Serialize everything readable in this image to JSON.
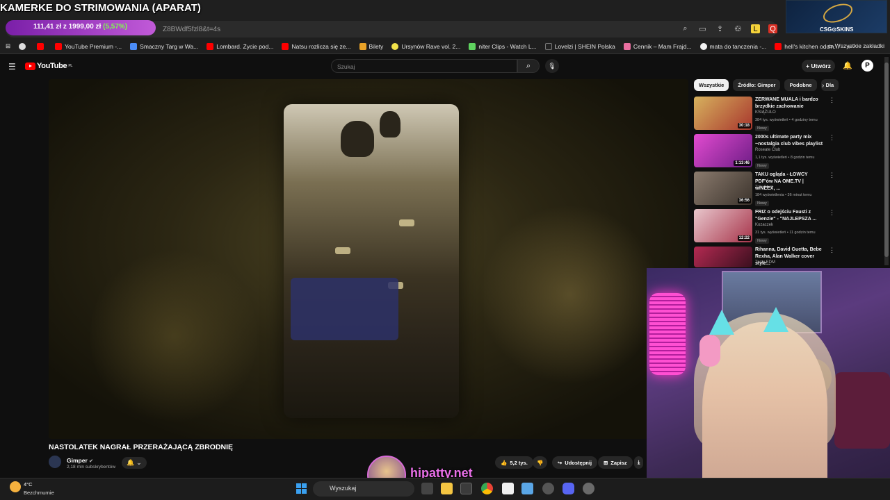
{
  "stream": {
    "title": "KAMERKE DO STRIMOWANIA (APARAT)",
    "goal": {
      "current": "111,41 zł",
      "sep": "z",
      "target": "1999,00 zł",
      "percent": "(5,57%)"
    }
  },
  "browser": {
    "url_fragment": "Z8BWdf5fzl8&t=4s",
    "bookmarks": [
      {
        "label": "YouTube Premium -...",
        "color": "#ff0000"
      },
      {
        "label": "Smaczny Targ w Wa...",
        "color": "#4b8df8"
      },
      {
        "label": "Lombard. Życie pod...",
        "color": "#ff0000"
      },
      {
        "label": "Natsu rozlicza się ze...",
        "color": "#ff0000"
      },
      {
        "label": "Bilety",
        "color": "#e9a227"
      },
      {
        "label": "Ursynów Rave vol. 2...",
        "color": "#f1e24a"
      },
      {
        "label": "niter Clips - Watch L...",
        "color": "#5fd35f"
      },
      {
        "label": "Lovelzi | SHEIN Polska",
        "color": "#222222"
      },
      {
        "label": "Cennik – Mam Frajd...",
        "color": "#e96fa0"
      },
      {
        "label": "mata do tanczenia -...",
        "color": "#f2f2f2"
      },
      {
        "label": "hell's kitchen odcin...",
        "color": "#ff0000"
      }
    ],
    "all_bookmarks": "Wszystkie zakładki",
    "csgo_label": "CSG⊙SKINS"
  },
  "youtube": {
    "logo": "YouTube",
    "region": "PL",
    "search_placeholder": "Szukaj",
    "create_label": "Utwórz",
    "avatar_letter": "P"
  },
  "video": {
    "title": "NASTOLATEK NAGRAŁ PRZERAŻAJĄCĄ ZBRODNIĘ",
    "channel": "Gimper",
    "subscribers": "2,18 mln subskrybentów",
    "likes": "5,2 tys.",
    "share": "Udostępnij",
    "save": "Zapisz"
  },
  "chips": [
    "Wszystkie",
    "Źródło: Gimper",
    "Podobne",
    "Dla"
  ],
  "recommendations": [
    {
      "title": "ZERWANE MUALA i bardzo brzydkie zachowanie",
      "channel": "KSIĄŻULO",
      "meta": "384 tys. wyświetleń • 4 godziny temu",
      "badge": "Nowy",
      "duration": "30:18",
      "thumb": "#c8a24f"
    },
    {
      "title": "2000s ultimate party mix ~nostalgia club vibes playlist",
      "channel": "Roseate Club",
      "meta": "1,1 tys. wyświetleń • 8 godzin temu",
      "badge": "Nowy",
      "duration": "1:13:46",
      "thumb": "#c03ab0"
    },
    {
      "title": "TAKU ogląda - ŁOWCY PDF'ów NA OME.TV | w/NEEX, ...",
      "channel": "TakuShot",
      "meta": "184 wyświetlenia • 36 minut temu",
      "badge": "Nowy",
      "duration": "36:56",
      "thumb": "#6d6257"
    },
    {
      "title": "FRIZ o odejściu Fausti z \"Genzie\" - \"NAJLEPSZA ...",
      "channel": "Kozaczek",
      "meta": "31 tys. wyświetleń • 11 godzin temu",
      "badge": "Nowy",
      "duration": "12:22",
      "thumb": "#d9a2ae"
    },
    {
      "title": "Rihanna, David Guetta, Bebe Rexha, Alan Walker cover style...",
      "channel": "Tasty EDM",
      "meta": "",
      "badge": "",
      "duration": "",
      "thumb": "#8a1f3e"
    }
  ],
  "overlay": {
    "brand": "hipatty.net"
  },
  "taskbar": {
    "temp": "4°C",
    "weather": "Bezchmurnie",
    "search": "Wyszukaj"
  }
}
